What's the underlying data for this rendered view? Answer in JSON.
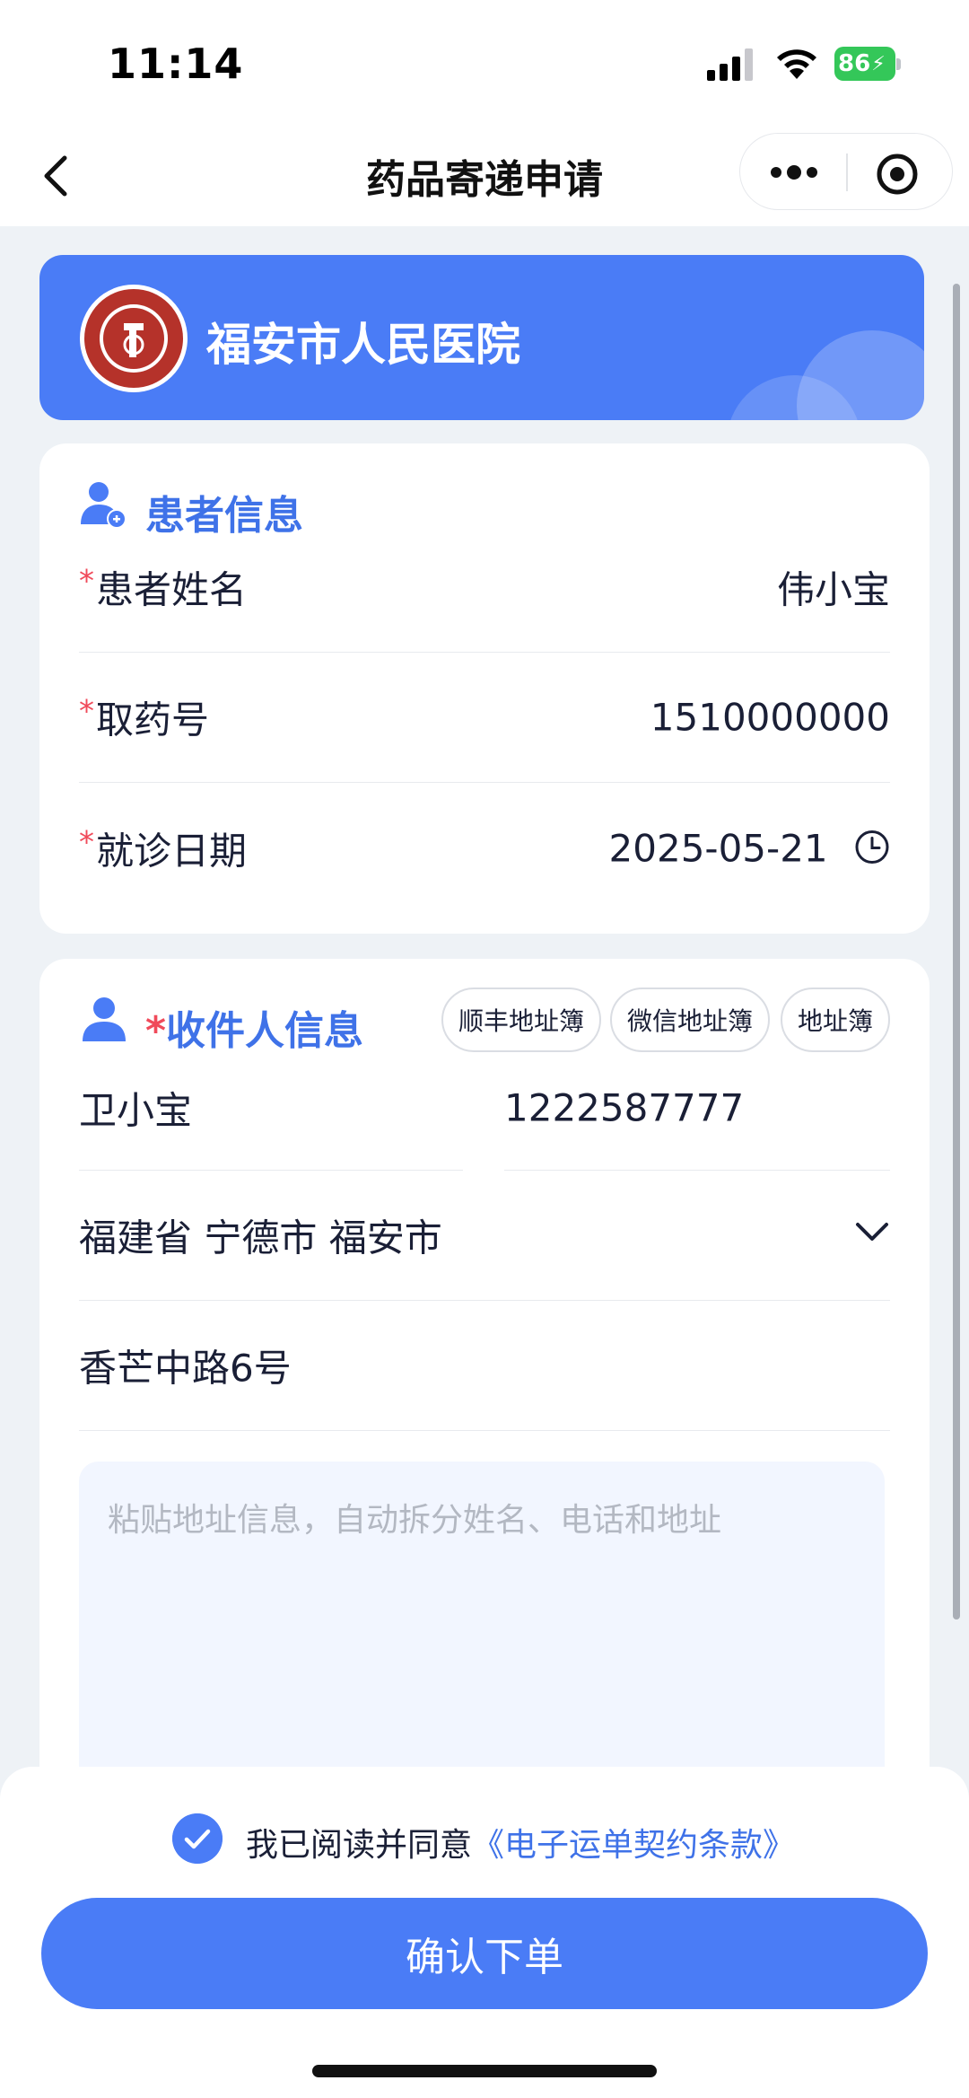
{
  "status_bar": {
    "time": "11:14",
    "battery": "86",
    "icons": [
      "signal-icon",
      "wifi-icon",
      "battery-charging-icon"
    ]
  },
  "nav": {
    "title": "药品寄递申请",
    "icons": [
      "back-icon",
      "more-icon",
      "target-icon"
    ]
  },
  "hospital": {
    "name": "福安市人民医院",
    "logo_icon": "hospital-logo-icon"
  },
  "patient_section": {
    "title": "患者信息",
    "icon": "patient-icon",
    "rows": [
      {
        "label": "患者姓名",
        "value": "伟小宝"
      },
      {
        "label": "取药号",
        "value": "1510000000"
      },
      {
        "label": "就诊日期",
        "value": "2025-05-21"
      }
    ]
  },
  "recipient_section": {
    "required_mark": "*",
    "title": "收件人信息",
    "icon": "user-icon",
    "address_books": [
      "顺丰地址簿",
      "微信地址簿",
      "地址簿"
    ],
    "name": "卫小宝",
    "phone": "1222587777",
    "region": "福建省 宁德市 福安市",
    "detail_address": "香芒中路6号",
    "paste_placeholder": "粘贴地址信息，自动拆分姓名、电话和地址"
  },
  "footer": {
    "agree_text": "我已阅读并同意",
    "agree_link": "《电子运单契约条款》",
    "confirm_label": "确认下单",
    "checked": true
  },
  "colors": {
    "primary": "#4A7CF6",
    "title_blue": "#3F72E8",
    "required": "#F04A5A",
    "background": "#EEF2F6"
  }
}
